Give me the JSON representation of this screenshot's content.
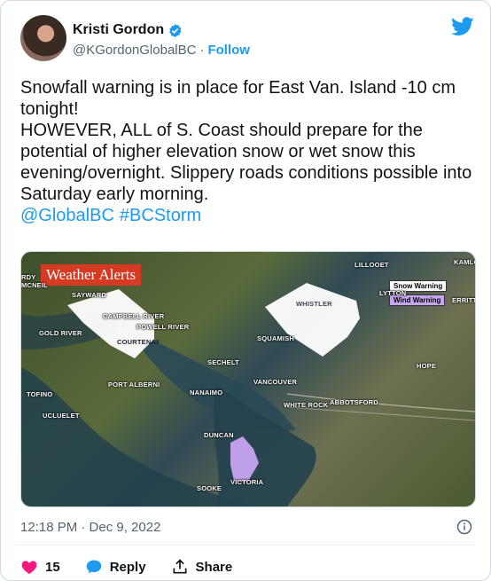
{
  "author": {
    "name": "Kristi Gordon",
    "handle": "@KGordonGlobalBC",
    "separator": "·",
    "follow_label": "Follow"
  },
  "tweet": {
    "text": "Snowfall warning is in place for East Van. Island -10 cm tonight!\nHOWEVER, ALL of S. Coast should prepare for the potential of higher elevation snow or wet snow this evening/overnight. Slippery roads conditions possible into Saturday early morning.",
    "mention": "@GlobalBC",
    "hashtag": "#BCStorm"
  },
  "media": {
    "title": "Weather Alerts",
    "legend": {
      "snow": "Snow Warning",
      "wind": "Wind Warning"
    },
    "labels": {
      "lillooet": "LILLOOET",
      "kamloops": "KAMLO",
      "sayward": "SAYWARD",
      "mcneill": "RDY\nMCNEIL",
      "campbell_river": "CAMPBELL RIVER",
      "powell_river": "POWELL RIVER",
      "courtenay": "COURTENAY",
      "whistler": "WHISTLER",
      "lytton": "LYTTON",
      "merritt": "ERRITT",
      "gold_river": "GOLD RIVER",
      "squamish": "SQUAMISH",
      "sechelt": "SECHELT",
      "hope": "HOPE",
      "port_alberni": "PORT ALBERNI",
      "vancouver": "VANCOUVER",
      "tofino": "TOFINO",
      "nanaimo": "NANAIMO",
      "white_rock": "WHITE ROCK",
      "abbotsford": "ABBOTSFORD",
      "ucluelet": "UCLUELET",
      "duncan": "DUNCAN",
      "sooke": "SOOKE",
      "victoria": "VICTORIA"
    },
    "colors": {
      "snow": "#ffffff",
      "wind": "#c7a4f0"
    }
  },
  "timestamp": "12:18 PM · Dec 9, 2022",
  "actions": {
    "likes": "15",
    "reply": "Reply",
    "share": "Share"
  },
  "colors": {
    "brand": "#1d9bf0",
    "like": "#f91880",
    "muted": "#536471"
  }
}
